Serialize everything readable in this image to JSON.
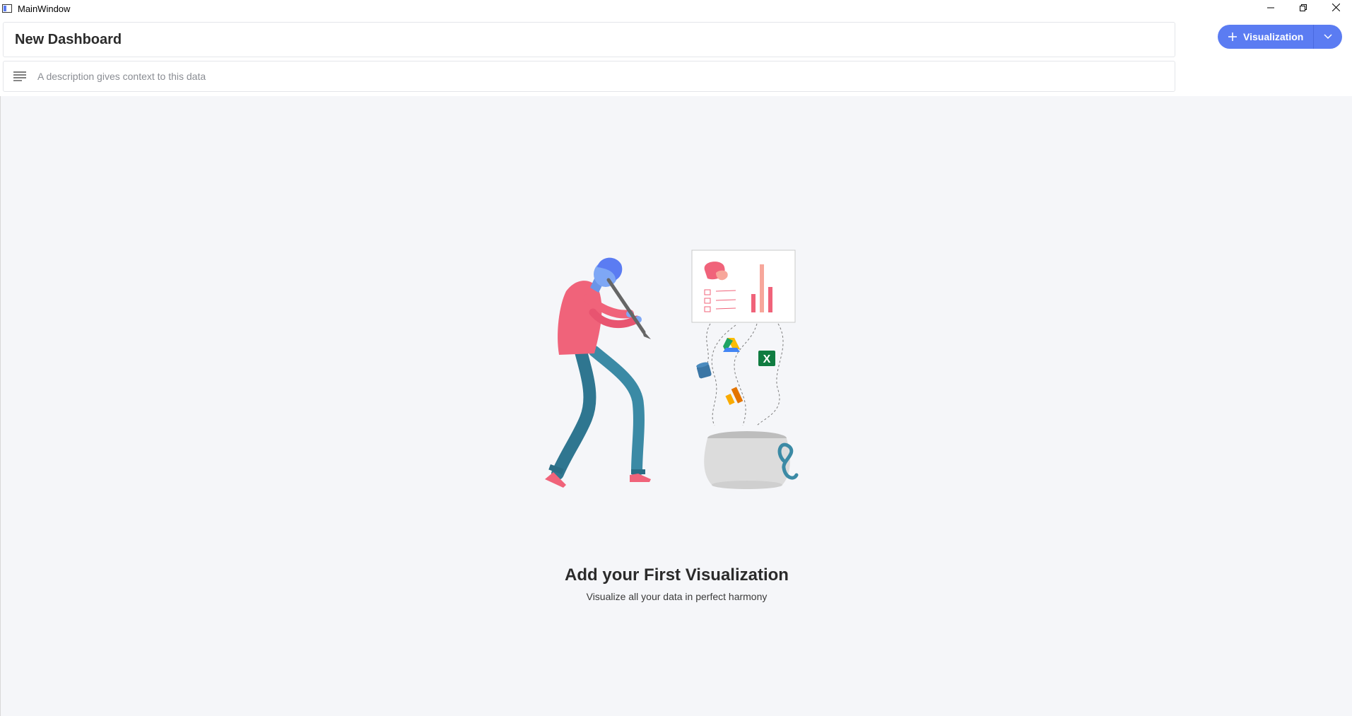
{
  "window": {
    "title": "MainWindow",
    "controls": [
      "minimize-icon",
      "restore-icon",
      "close-icon"
    ]
  },
  "dashboard": {
    "title": "New Dashboard",
    "description_placeholder": "A description gives context to this data",
    "description_icon": "paragraph-lines-icon"
  },
  "toolbar": {
    "add_visualization_label": "Visualization",
    "add_icon": "plus-icon",
    "dropdown_icon": "chevron-down-icon",
    "accent_color": "#5b7cf2"
  },
  "empty_state": {
    "title": "Add your First Visualization",
    "subtitle": "Visualize all your data in perfect harmony",
    "illustration_icons": [
      "google-drive-icon",
      "excel-icon",
      "database-icon",
      "analytics-icon"
    ]
  },
  "colors": {
    "canvas_bg": "#f5f6f9",
    "figure_shirt": "#f0637a",
    "figure_pants": "#3b8aa5",
    "figure_skin": "#5f8ef0"
  }
}
